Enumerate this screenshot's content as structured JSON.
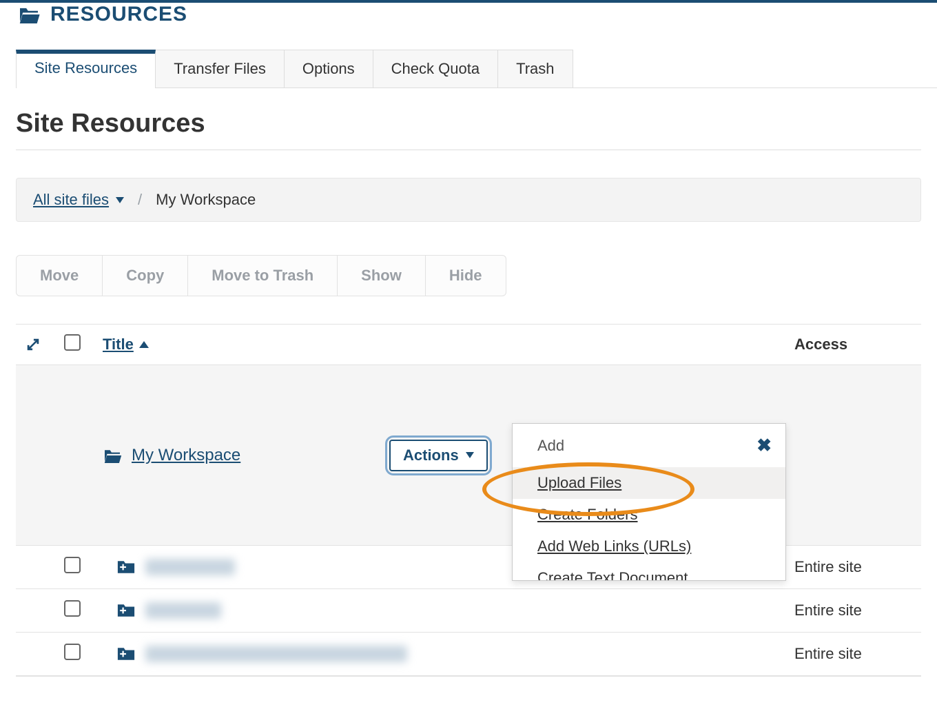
{
  "header": {
    "title": "RESOURCES"
  },
  "tabs": [
    {
      "label": "Site Resources",
      "active": true
    },
    {
      "label": "Transfer Files"
    },
    {
      "label": "Options"
    },
    {
      "label": "Check Quota"
    },
    {
      "label": "Trash"
    }
  ],
  "page_title": "Site Resources",
  "breadcrumb": {
    "root": "All site files",
    "current": "My Workspace"
  },
  "toolbar": {
    "move": "Move",
    "copy": "Copy",
    "trash": "Move to Trash",
    "show": "Show",
    "hide": "Hide"
  },
  "table": {
    "columns": {
      "title": "Title",
      "access": "Access"
    },
    "root_folder": "My Workspace",
    "actions_label": "Actions",
    "rows": [
      {
        "access": "Entire site"
      },
      {
        "access": "Entire site"
      },
      {
        "access": "Entire site"
      }
    ]
  },
  "dropdown": {
    "header": "Add",
    "items": [
      "Upload Files",
      "Create Folders",
      "Add Web Links (URLs)",
      "Create Text Document"
    ]
  }
}
